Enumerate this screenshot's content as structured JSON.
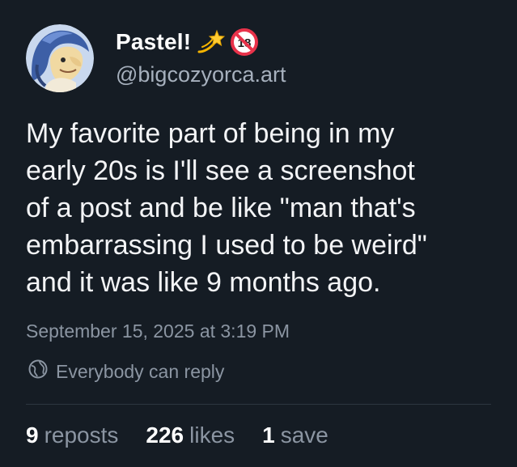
{
  "author": {
    "display_name": "Pastel!",
    "handle": "@bigcozyorca.art",
    "badges": [
      "dizzy-star-emoji",
      "no-one-under-18-emoji"
    ]
  },
  "post": {
    "text": "My favorite part of being in my\nearly 20s is I'll see a screenshot\nof a post and be like \"man that's\nembarrassing I used to be weird\"\nand it was like 9 months ago.",
    "timestamp": "September 15, 2025 at 3:19 PM",
    "reply_setting": "Everybody can reply"
  },
  "stats": {
    "reposts_count": "9",
    "reposts_label": "reposts",
    "likes_count": "226",
    "likes_label": "likes",
    "saves_count": "1",
    "saves_label": "save"
  },
  "colors": {
    "background": "#151c24",
    "text_primary": "#f3f4f6",
    "text_secondary": "#8b95a2"
  }
}
